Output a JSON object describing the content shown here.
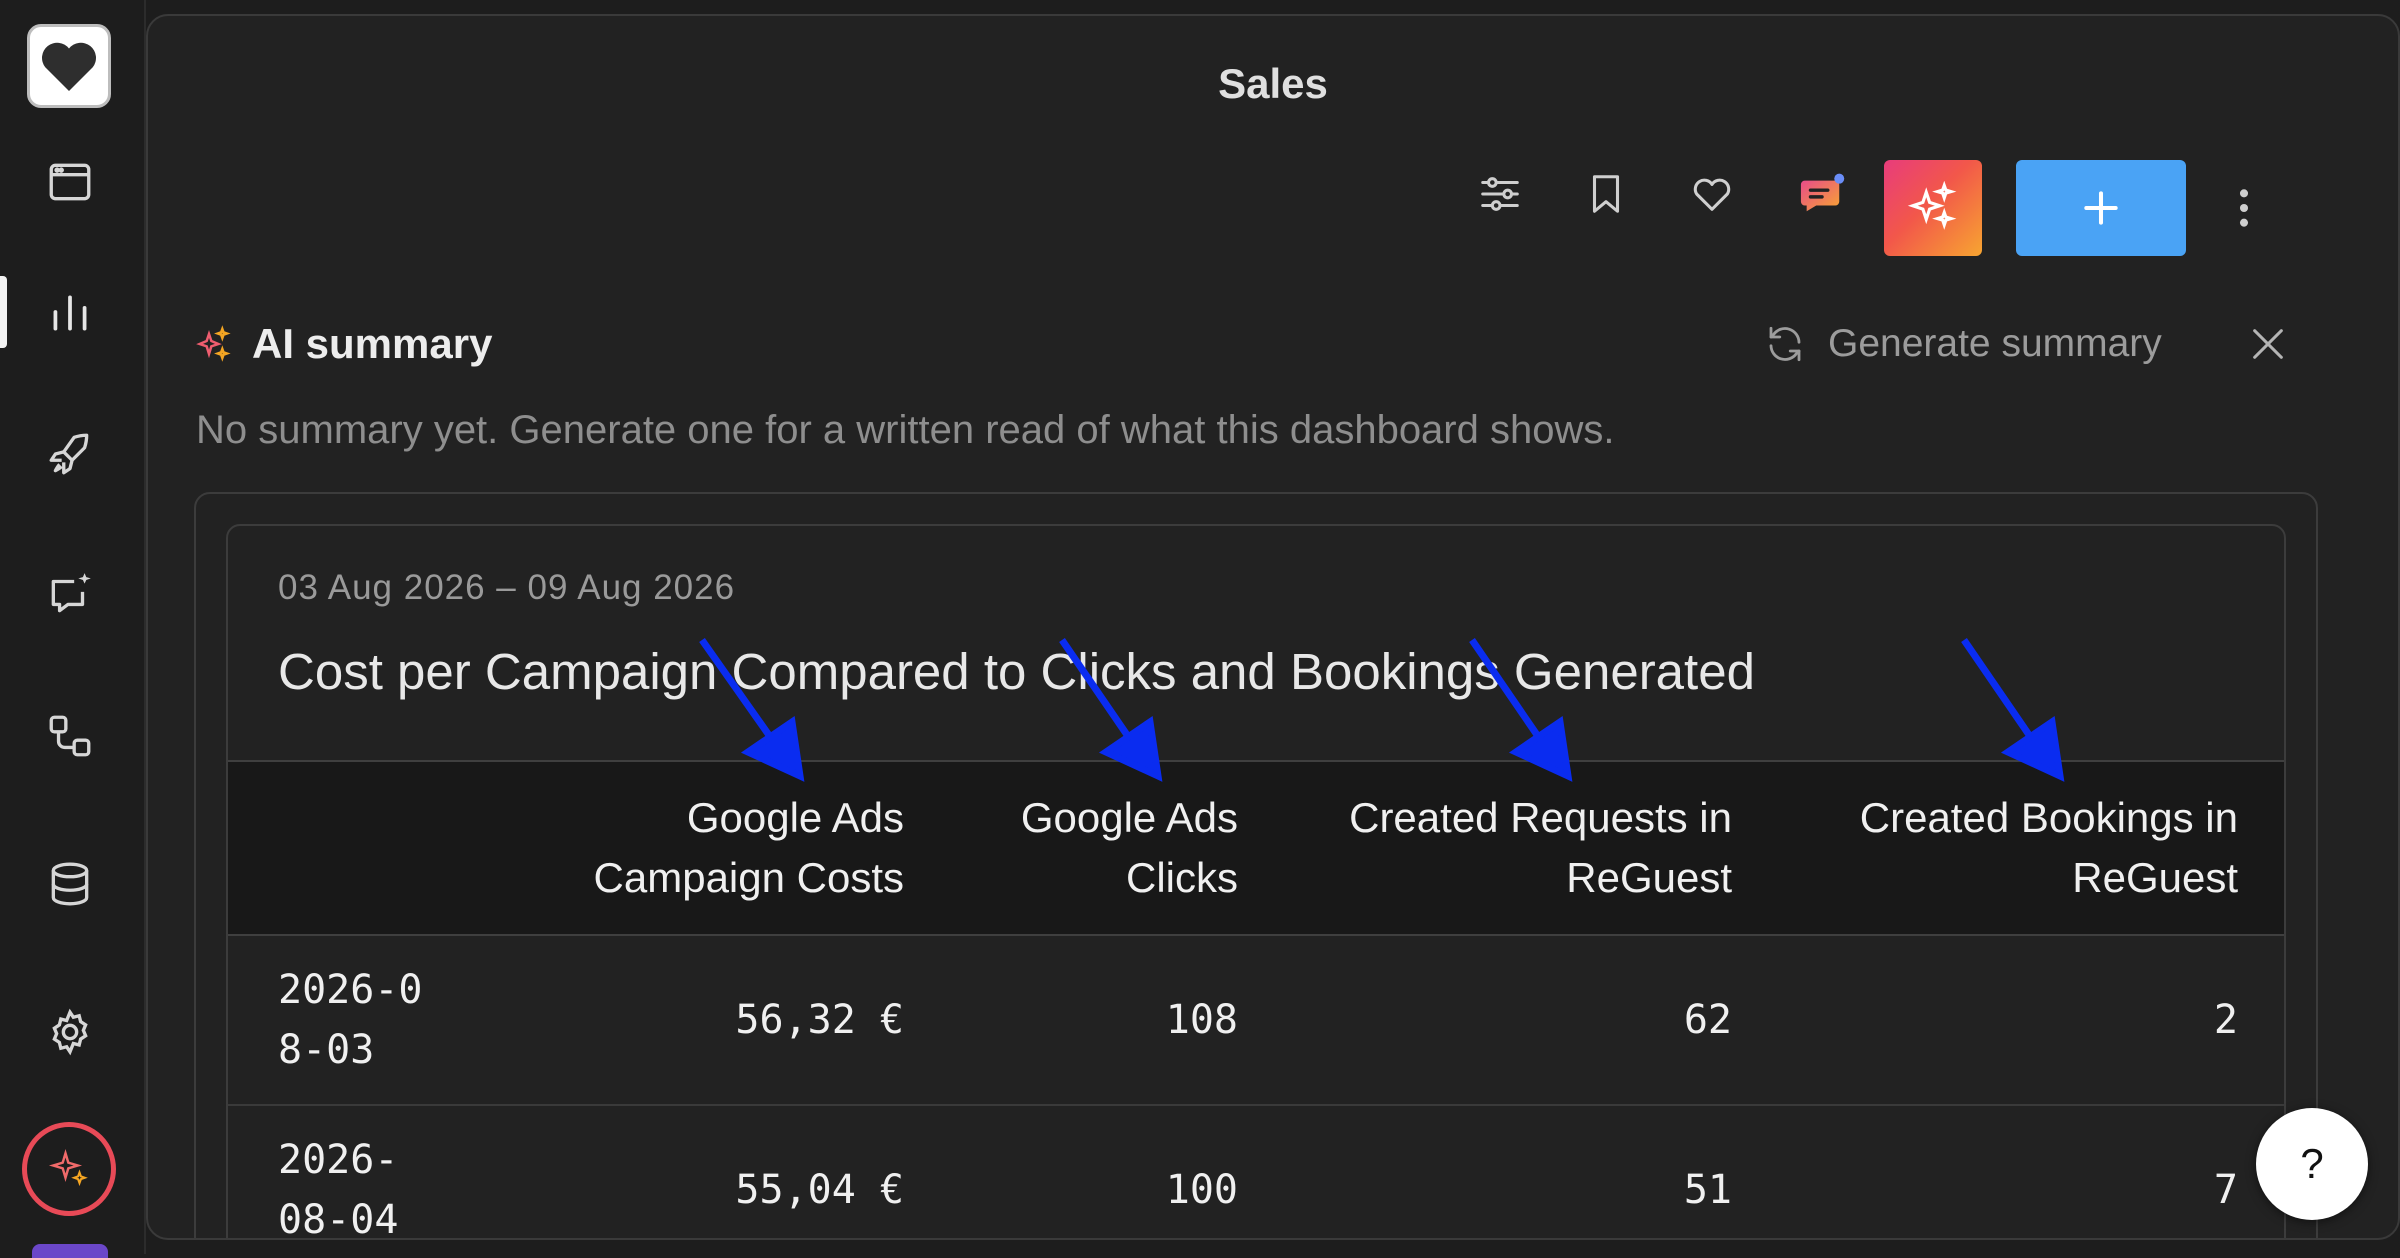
{
  "sidebar": {
    "items": [
      {
        "icon": "browser-window-icon"
      },
      {
        "icon": "bar-chart-icon",
        "active": true
      },
      {
        "icon": "rocket-icon"
      },
      {
        "icon": "chat-sparkle-icon"
      },
      {
        "icon": "workflow-icon"
      },
      {
        "icon": "database-icon"
      },
      {
        "icon": "gear-icon"
      }
    ],
    "logo_icon": "heart-icon",
    "ai_button_icon": "sparkle-icon"
  },
  "header": {
    "title": "Sales"
  },
  "toolbar": {
    "icons": [
      "filter-sliders-icon",
      "bookmark-icon",
      "heart-outline-icon",
      "chat-icon",
      "sparkle-icon",
      "plus-icon",
      "more-vertical-icon"
    ],
    "add_button_color": "#4aa3f5"
  },
  "ai_summary": {
    "label": "AI summary",
    "generate_label": "Generate summary",
    "empty_text": "No summary yet. Generate one for a written read of what this dashboard shows."
  },
  "report": {
    "date_range": "03 Aug 2026 – 09 Aug 2026",
    "title": "Cost per Campaign Compared to Clicks and Bookings Generated",
    "columns": [
      "",
      "Google Ads Campaign Costs",
      "Google Ads Clicks",
      "Created Requests in ReGuest",
      "Created Bookings in ReGuest"
    ],
    "rows": [
      [
        "2026-08-03",
        "56,32 €",
        "108",
        "62",
        "2"
      ],
      [
        "2026-08-04",
        "55,04 €",
        "100",
        "51",
        "7"
      ]
    ]
  },
  "annotations": {
    "arrow_color": "#0a2cf0",
    "arrow_count": 4
  },
  "help": {
    "label": "?"
  }
}
